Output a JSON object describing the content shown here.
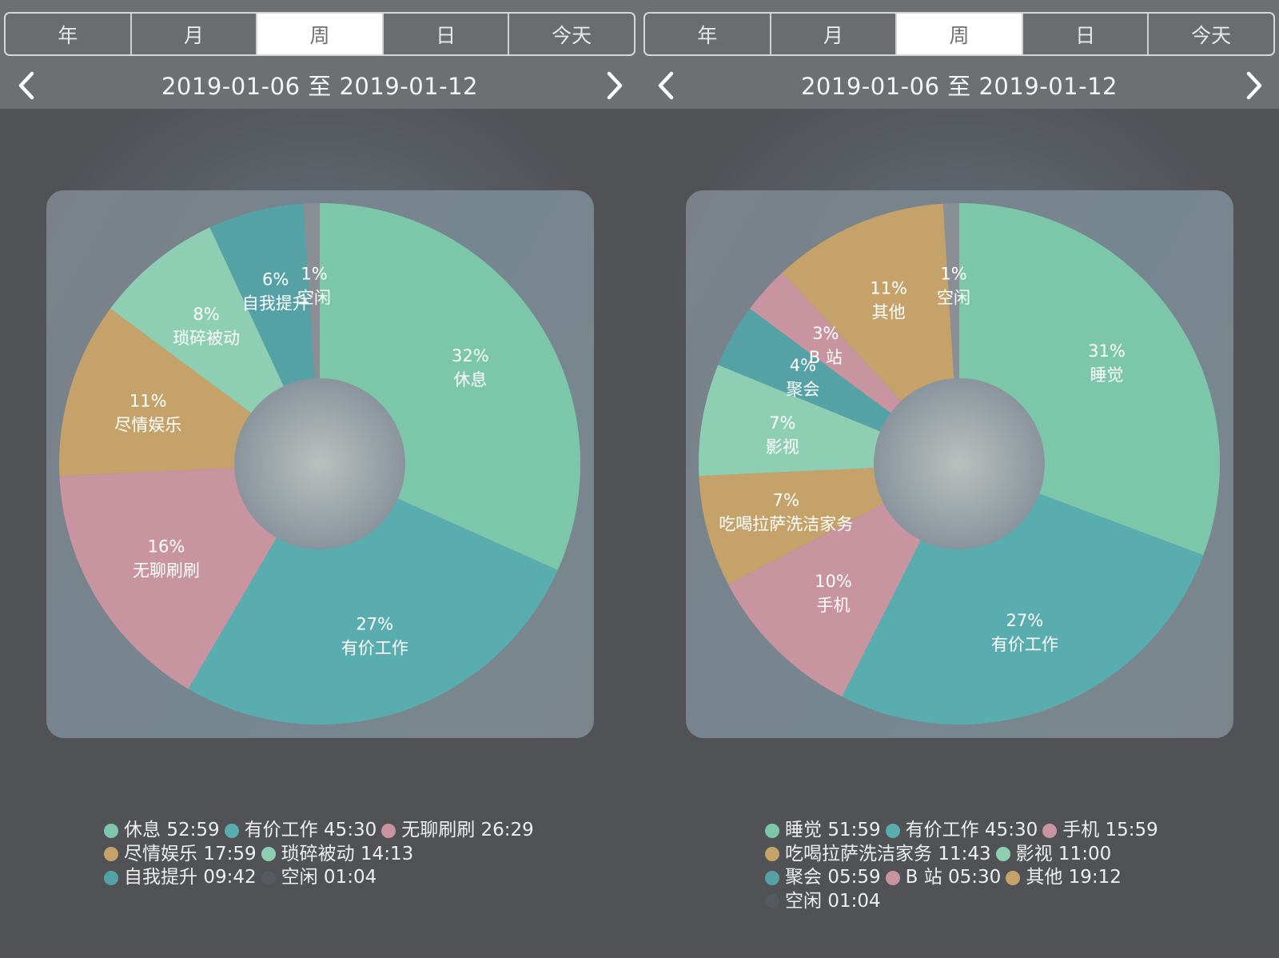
{
  "left": {
    "tabs": [
      {
        "label": "年",
        "active": false
      },
      {
        "label": "月",
        "active": false
      },
      {
        "label": "周",
        "active": true
      },
      {
        "label": "日",
        "active": false
      },
      {
        "label": "今天",
        "active": false
      }
    ],
    "date_range": "2019-01-06 至 2019-01-12",
    "chart_data": {
      "type": "pie",
      "donut": true,
      "slices": [
        {
          "label": "休息",
          "percent": 32,
          "color": "#7cc7a9"
        },
        {
          "label": "有价工作",
          "percent": 27,
          "color": "#5aadaf"
        },
        {
          "label": "无聊刷刷",
          "percent": 16,
          "color": "#c7949f"
        },
        {
          "label": "尽情娱乐",
          "percent": 11,
          "color": "#c4a26a"
        },
        {
          "label": "琐碎被动",
          "percent": 8,
          "color": "#8ecfb3"
        },
        {
          "label": "自我提升",
          "percent": 6,
          "color": "#55a2a6"
        },
        {
          "label": "空闲",
          "percent": 1,
          "color": "#8a8f96"
        }
      ]
    },
    "legend": [
      [
        {
          "label": "休息",
          "value": "52:59",
          "color": "#7cc7a9"
        },
        {
          "label": "有价工作",
          "value": "45:30",
          "color": "#5aadaf"
        },
        {
          "label": "无聊刷刷",
          "value": "26:29",
          "color": "#c7949f"
        }
      ],
      [
        {
          "label": "尽情娱乐",
          "value": "17:59",
          "color": "#c4a26a"
        },
        {
          "label": "琐碎被动",
          "value": "14:13",
          "color": "#8ecfb3"
        }
      ],
      [
        {
          "label": "自我提升",
          "value": "09:42",
          "color": "#55a2a6"
        },
        {
          "label": "空闲",
          "value": "01:04",
          "color": "#555a60"
        }
      ]
    ]
  },
  "right": {
    "tabs": [
      {
        "label": "年",
        "active": false
      },
      {
        "label": "月",
        "active": false
      },
      {
        "label": "周",
        "active": true
      },
      {
        "label": "日",
        "active": false
      },
      {
        "label": "今天",
        "active": false
      }
    ],
    "date_range": "2019-01-06 至 2019-01-12",
    "chart_data": {
      "type": "pie",
      "donut": true,
      "slices": [
        {
          "label": "睡觉",
          "percent": 31,
          "color": "#7cc7a9"
        },
        {
          "label": "有价工作",
          "percent": 27,
          "color": "#5aadaf"
        },
        {
          "label": "手机",
          "percent": 10,
          "color": "#c7949f"
        },
        {
          "label": "吃喝拉萨洗洁家务",
          "percent": 7,
          "color": "#c4a26a"
        },
        {
          "label": "影视",
          "percent": 7,
          "color": "#8ecfb3"
        },
        {
          "label": "聚会",
          "percent": 4,
          "color": "#55a2a6"
        },
        {
          "label": "B 站",
          "percent": 3,
          "color": "#c7949f"
        },
        {
          "label": "其他",
          "percent": 11,
          "color": "#c4a26a"
        },
        {
          "label": "空闲",
          "percent": 1,
          "color": "#8a8f96"
        }
      ]
    },
    "legend": [
      [
        {
          "label": "睡觉",
          "value": "51:59",
          "color": "#7cc7a9"
        },
        {
          "label": "有价工作",
          "value": "45:30",
          "color": "#5aadaf"
        },
        {
          "label": "手机",
          "value": "15:59",
          "color": "#c7949f"
        }
      ],
      [
        {
          "label": "吃喝拉萨洗洁家务",
          "value": "11:43",
          "color": "#c4a26a"
        },
        {
          "label": "影视",
          "value": "11:00",
          "color": "#8ecfb3"
        }
      ],
      [
        {
          "label": "聚会",
          "value": "05:59",
          "color": "#55a2a6"
        },
        {
          "label": "B 站",
          "value": "05:30",
          "color": "#c7949f"
        },
        {
          "label": "其他",
          "value": "19:12",
          "color": "#c4a26a"
        }
      ],
      [
        {
          "label": "空闲",
          "value": "01:04",
          "color": "#555a60"
        }
      ]
    ]
  }
}
